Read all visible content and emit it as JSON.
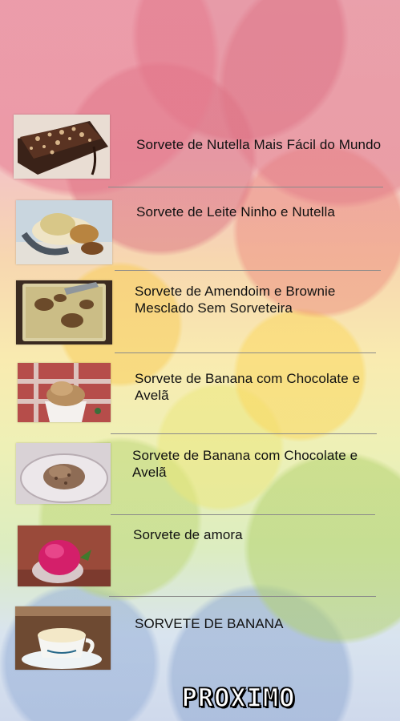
{
  "recipes": [
    {
      "title": "Sorvete de Nutella Mais Fácil do Mundo"
    },
    {
      "title": "Sorvete de Leite Ninho e Nutella"
    },
    {
      "title": "Sorvete de Amendoim e Brownie Mesclado Sem Sorveteira"
    },
    {
      "title": "Sorvete de Banana com Chocolate e Avelã"
    },
    {
      "title": "Sorvete de Banana com Chocolate e Avelã"
    },
    {
      "title": "Sorvete de amora"
    },
    {
      "title": "SORVETE DE BANANA"
    }
  ],
  "next_button": {
    "label": "PROXIMO"
  }
}
